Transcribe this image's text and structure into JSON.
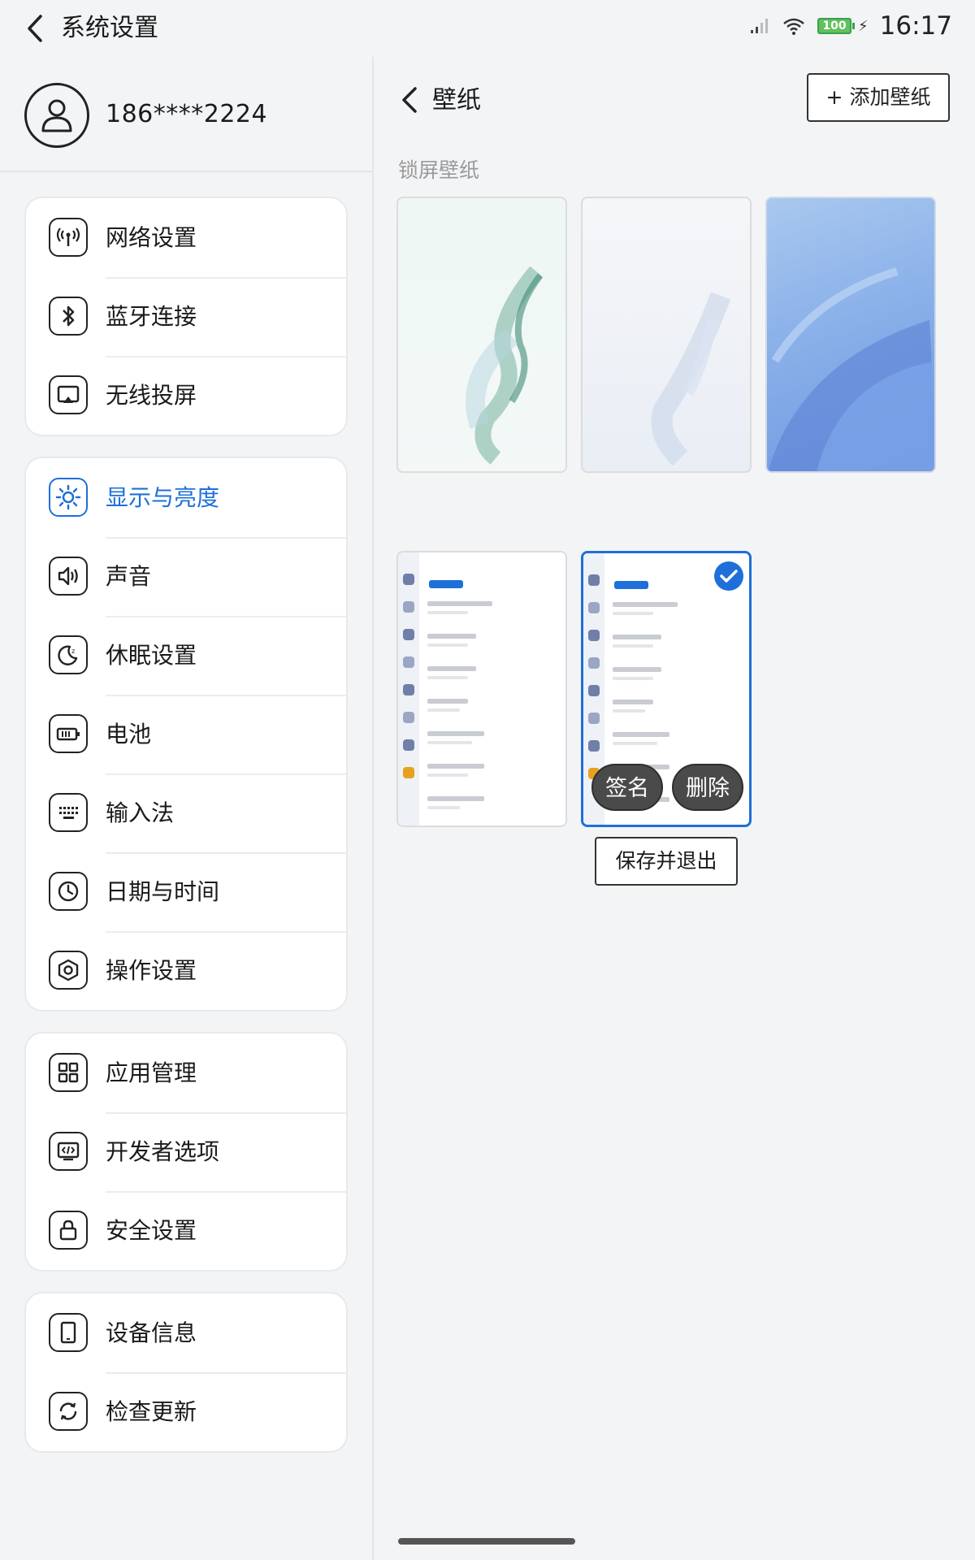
{
  "header": {
    "title": "系统设置",
    "time": "16:17",
    "battery": "100"
  },
  "profile": {
    "phone": "186****2224"
  },
  "menu_groups": [
    {
      "items": [
        {
          "label": "网络设置",
          "icon": "antenna-icon"
        },
        {
          "label": "蓝牙连接",
          "icon": "bluetooth-icon"
        },
        {
          "label": "无线投屏",
          "icon": "cast-icon"
        }
      ]
    },
    {
      "items": [
        {
          "label": "显示与亮度",
          "icon": "brightness-icon",
          "active": true
        },
        {
          "label": "声音",
          "icon": "speaker-icon"
        },
        {
          "label": "休眠设置",
          "icon": "moon-icon"
        },
        {
          "label": "电池",
          "icon": "battery-icon"
        },
        {
          "label": "输入法",
          "icon": "keyboard-icon"
        },
        {
          "label": "日期与时间",
          "icon": "clock-icon"
        },
        {
          "label": "操作设置",
          "icon": "hex-gear-icon"
        }
      ]
    },
    {
      "items": [
        {
          "label": "应用管理",
          "icon": "grid-icon"
        },
        {
          "label": "开发者选项",
          "icon": "code-icon"
        },
        {
          "label": "安全设置",
          "icon": "lock-icon"
        }
      ]
    },
    {
      "items": [
        {
          "label": "设备信息",
          "icon": "tablet-icon"
        },
        {
          "label": "检查更新",
          "icon": "refresh-icon"
        }
      ]
    }
  ],
  "wallpaper": {
    "title": "壁纸",
    "add_button": "+ 添加壁纸",
    "section_label": "锁屏壁纸",
    "sign_button": "签名",
    "delete_button": "删除",
    "save_button": "保存并退出"
  },
  "colors": {
    "accent": "#1e6fd9",
    "battery": "#62c15c"
  }
}
